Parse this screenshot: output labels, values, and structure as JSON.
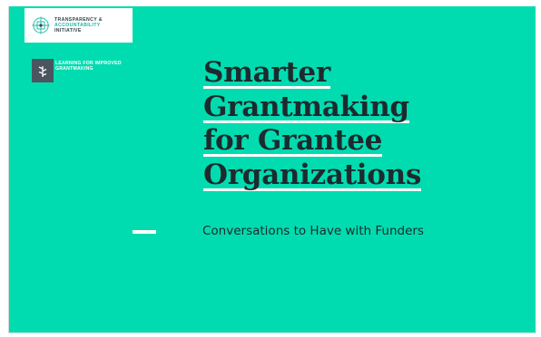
{
  "colors": {
    "background": "#00dcb0",
    "title_text": "#1d2a2e",
    "title_underline": "#ffffff",
    "subtitle_text": "#1d2a2e",
    "tai_teal": "#16b8a4",
    "tai_dark": "#33414a",
    "badge_bg": "#4a5560",
    "white": "#ffffff"
  },
  "tai_logo": {
    "icon": "tai-logo-icon",
    "lines": [
      "TRANSPARENCY &",
      "ACCOUNTABILITY",
      "INITIATIVE"
    ]
  },
  "lig_logo": {
    "icon": "sprout-icon",
    "lines": [
      "LEARNING FOR IMPROVED",
      "GRANTMAKING"
    ]
  },
  "title_lines": [
    "Smarter",
    "Grantmaking",
    "for Grantee",
    "Organizations"
  ],
  "subtitle": "Conversations to Have with Funders"
}
